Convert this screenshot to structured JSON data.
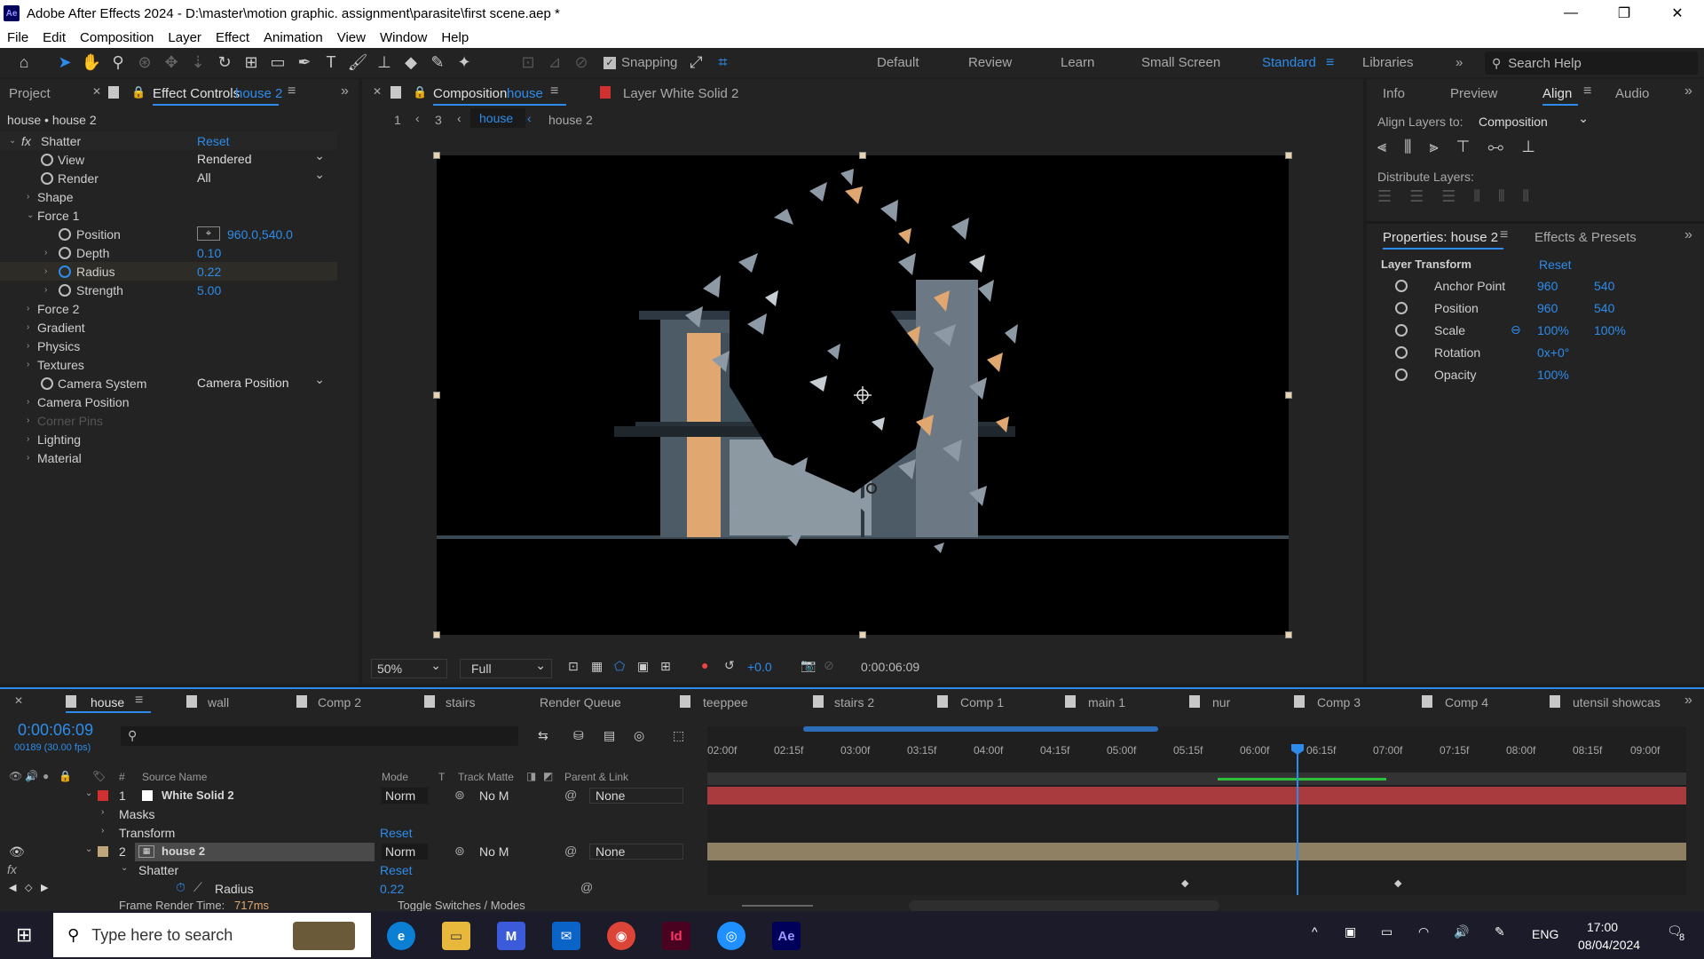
{
  "title": "Adobe After Effects 2024 - D:\\master\\motion graphic. assignment\\parasite\\first scene.aep *",
  "app_logo": "Ae",
  "menu": [
    "File",
    "Edit",
    "Composition",
    "Layer",
    "Effect",
    "Animation",
    "View",
    "Window",
    "Help"
  ],
  "toolbar": {
    "snapping_label": "Snapping",
    "workspaces": [
      "Default",
      "Review",
      "Learn",
      "Small Screen",
      "Standard",
      "Libraries"
    ],
    "active_workspace": "Standard",
    "search_placeholder": "Search Help"
  },
  "left_panel": {
    "project_tab": "Project",
    "effect_controls_tab": "Effect Controls",
    "effect_controls_layer": "house 2",
    "breadcrumb": "house • house 2",
    "effect_name": "Shatter",
    "reset": "Reset",
    "rows": {
      "view": {
        "label": "View",
        "value": "Rendered"
      },
      "render": {
        "label": "Render",
        "value": "All"
      },
      "shape": "Shape",
      "force1": "Force 1",
      "position": {
        "label": "Position",
        "value": "960.0,540.0"
      },
      "depth": {
        "label": "Depth",
        "value": "0.10"
      },
      "radius": {
        "label": "Radius",
        "value": "0.22"
      },
      "strength": {
        "label": "Strength",
        "value": "5.00"
      },
      "force2": "Force 2",
      "gradient": "Gradient",
      "physics": "Physics",
      "textures": "Textures",
      "camera_system": {
        "label": "Camera System",
        "value": "Camera Position"
      },
      "camera_position": "Camera Position",
      "corner_pins": "Corner Pins",
      "lighting": "Lighting",
      "material": "Material"
    }
  },
  "composition_panel": {
    "tab_label": "Composition",
    "tab_comp": "house",
    "layer_tab_label": "Layer",
    "layer_tab_name": "White Solid 2",
    "nav_num1": "1",
    "nav_num2": "3",
    "crumb_active": "house",
    "crumb_next": "house 2",
    "zoom": "50%",
    "resolution": "Full",
    "exposure": "+0.0",
    "timecode": "0:00:06:09"
  },
  "right_panel": {
    "tabs": [
      "Info",
      "Preview",
      "Align",
      "Audio"
    ],
    "active_tab": "Align",
    "align_to_label": "Align Layers to:",
    "align_to_value": "Composition",
    "distribute_label": "Distribute Layers:",
    "props_tab": "Properties: house 2",
    "effects_tab": "Effects & Presets",
    "layer_transform": "Layer Transform",
    "reset": "Reset",
    "props": [
      {
        "label": "Anchor Point",
        "v1": "960",
        "v2": "540"
      },
      {
        "label": "Position",
        "v1": "960",
        "v2": "540"
      },
      {
        "label": "Scale",
        "v1": "100%",
        "v2": "100%"
      },
      {
        "label": "Rotation",
        "v1": "0x+0°",
        "v2": ""
      },
      {
        "label": "Opacity",
        "v1": "100%",
        "v2": ""
      }
    ]
  },
  "timeline": {
    "tabs": [
      "house",
      "wall",
      "Comp 2",
      "stairs",
      "Render Queue",
      "teeppee",
      "stairs 2",
      "Comp 1",
      "main 1",
      "nur",
      "Comp 3",
      "Comp 4",
      "utensil showcas"
    ],
    "active_tab": "house",
    "timecode": "0:00:06:09",
    "frame_info": "00189 (30.00 fps)",
    "columns": {
      "num": "#",
      "source": "Source Name",
      "mode": "Mode",
      "t": "T",
      "track_matte": "Track Matte",
      "parent": "Parent & Link"
    },
    "ruler": [
      "02:00f",
      "02:15f",
      "03:00f",
      "03:15f",
      "04:00f",
      "04:15f",
      "05:00f",
      "05:15f",
      "06:00f",
      "06:15f",
      "07:00f",
      "07:15f",
      "08:00f",
      "08:15f",
      "09:00f"
    ],
    "layers": [
      {
        "num": "1",
        "name": "White Solid 2",
        "mode": "Norm",
        "matte": "No M",
        "parent": "None"
      },
      {
        "num": "2",
        "name": "house 2",
        "mode": "Norm",
        "matte": "No M",
        "parent": "None"
      }
    ],
    "sub_masks": "Masks",
    "sub_transform": "Transform",
    "sub_shatter": "Shatter",
    "sub_radius": "Radius",
    "radius_value": "0.22",
    "reset": "Reset",
    "frame_render_label": "Frame Render Time:",
    "frame_render_value": "717ms",
    "toggle_label": "Toggle Switches / Modes"
  },
  "taskbar": {
    "search_placeholder": "Type here to search",
    "language": "ENG",
    "time": "17:00",
    "date": "08/04/2024",
    "notification_count": "8"
  }
}
